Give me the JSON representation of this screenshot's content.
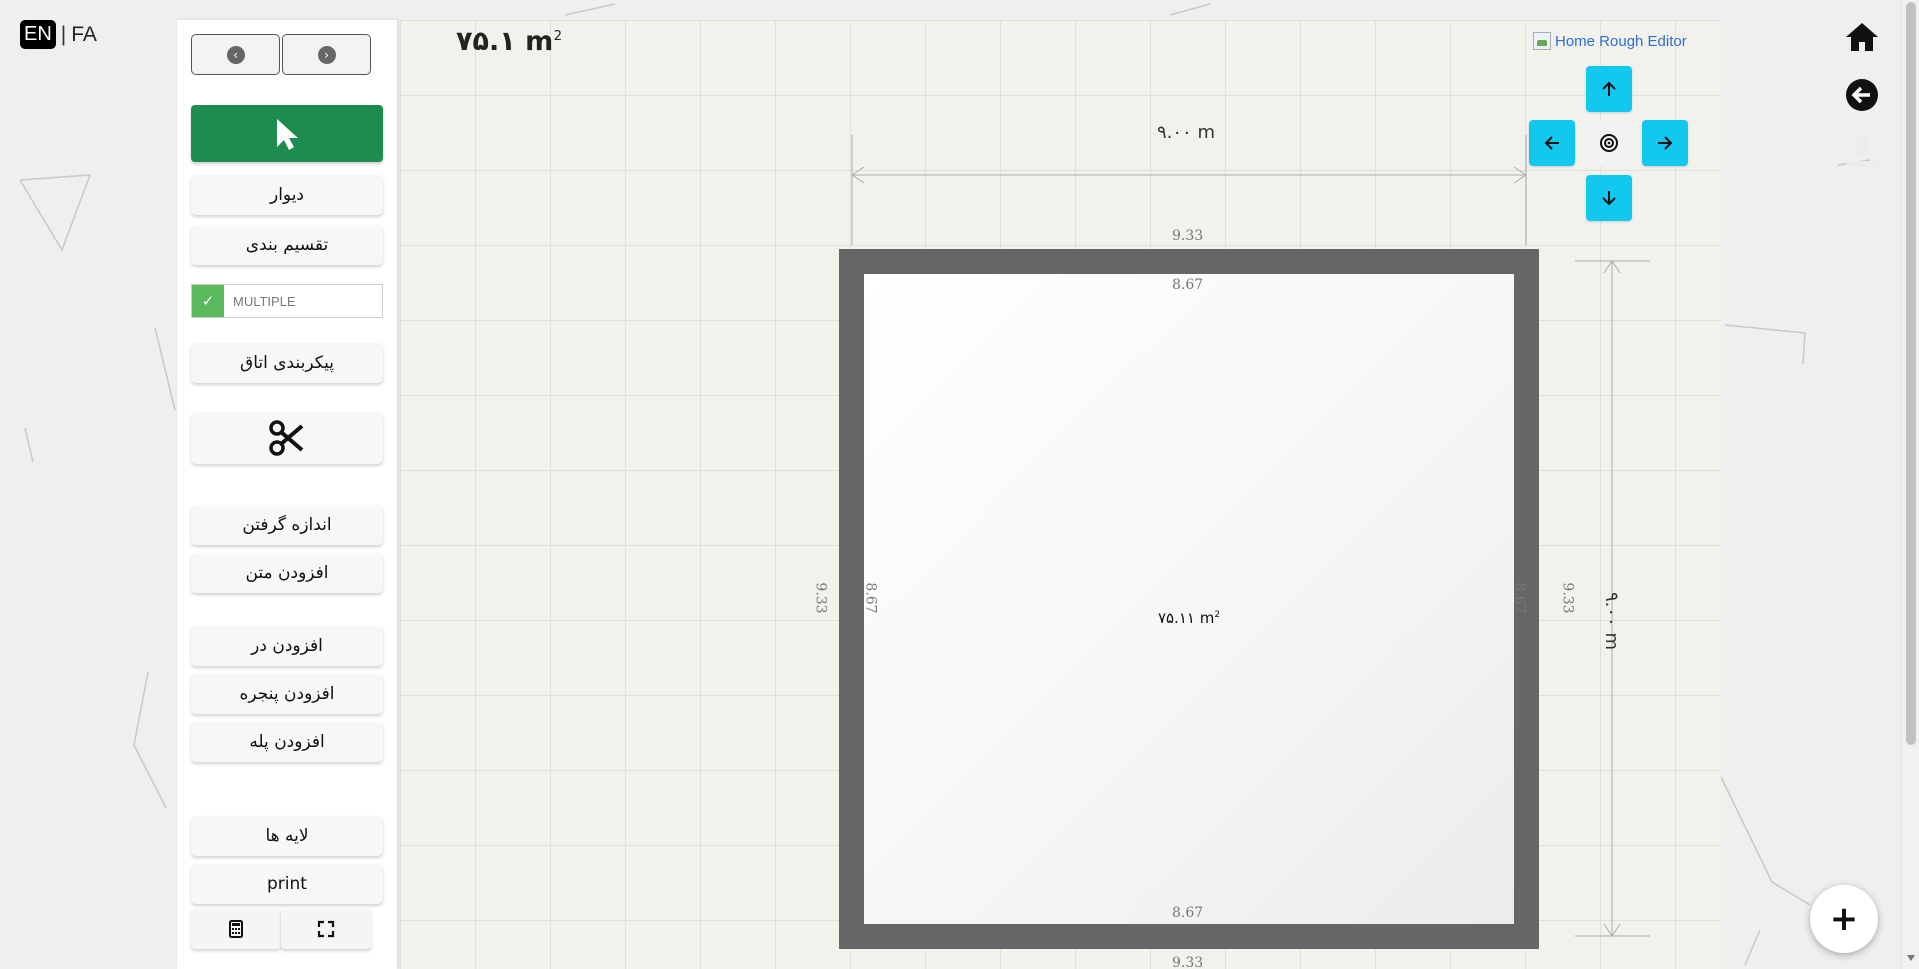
{
  "lang": {
    "en": "EN",
    "separator": "|",
    "fa": "FA"
  },
  "nav": {
    "back_icon": "chevron-left-icon",
    "forward_icon": "chevron-right-icon"
  },
  "tools": {
    "select_icon": "cursor-icon",
    "wall": "دیوار",
    "partition": "تقسیم بندی",
    "multiple_label": "MULTIPLE",
    "room_config": "پیکربندی اتاق",
    "cut_icon": "scissors-icon",
    "measure": "اندازه گرفتن",
    "add_text": "افزودن متن",
    "add_door": "افزودن در",
    "add_window": "افزودن پنجره",
    "add_stair": "افزودن پله",
    "layers": "لایه ها",
    "print": "print",
    "calculator_icon": "calculator-icon",
    "fullscreen_icon": "fullscreen-icon"
  },
  "canvas": {
    "total_area": "۷۵.۱ m",
    "total_area_sup": "2",
    "room_area": "۷۵.۱۱ m",
    "room_area_sup": "2",
    "dim_top": "۹.۰۰ m",
    "dim_right": "۹.۰۰ m",
    "outer_top": "9.33",
    "inner_top": "8.67",
    "inner_bottom": "8.67",
    "outer_bottom": "9.33",
    "outer_left": "9.33",
    "inner_left": "8.67",
    "inner_right": "8.67",
    "outer_right": "9.33",
    "brand": "Home Rough Editor",
    "pan_up_icon": "arrow-up-icon",
    "pan_down_icon": "arrow-down-icon",
    "pan_left_icon": "arrow-left-icon",
    "pan_right_icon": "arrow-right-icon",
    "pan_center_icon": "target-icon"
  },
  "right": {
    "home_icon": "home-icon",
    "back_icon": "circle-arrow-left-icon",
    "download_icon": "download-icon",
    "add_icon": "plus-icon",
    "add_label": "+"
  },
  "colors": {
    "select_button": "#1e8c4e",
    "pan_buttons": "#12c8ef",
    "wall": "#666666",
    "multiple_check": "#5cb85c",
    "brand_link": "#2b6fd6"
  }
}
